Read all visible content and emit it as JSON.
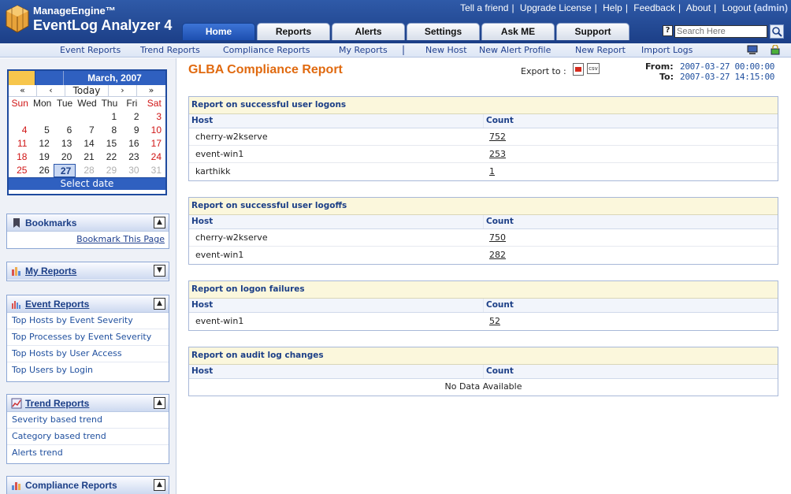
{
  "app": {
    "brand_top": "ManageEngine™",
    "brand_name": "EventLog Analyzer 4"
  },
  "top_links": [
    "Tell a friend",
    "Upgrade License",
    "Help",
    "Feedback",
    "About",
    "Logout"
  ],
  "user": "(admin)",
  "tabs": [
    {
      "label": "Home",
      "active": true
    },
    {
      "label": "Reports",
      "active": false
    },
    {
      "label": "Alerts",
      "active": false
    },
    {
      "label": "Settings",
      "active": false
    },
    {
      "label": "Ask ME",
      "active": false
    },
    {
      "label": "Support",
      "active": false
    }
  ],
  "search": {
    "placeholder": "Search Here",
    "help_icon": "question-icon",
    "button_icon": "magnifier-icon"
  },
  "subnav": [
    "Event Reports",
    "Trend Reports",
    "Compliance Reports",
    "My Reports",
    "New Host",
    "New Alert Profile",
    "New Report",
    "Import Logs"
  ],
  "subnav_sep": "|",
  "calendar": {
    "month": "March, 2007",
    "nav": [
      "«",
      "‹",
      "Today",
      "›",
      "»"
    ],
    "dow": [
      "Sun",
      "Mon",
      "Tue",
      "Wed",
      "Thu",
      "Fri",
      "Sat"
    ],
    "weeks": [
      [
        "",
        "",
        "",
        "",
        "1",
        "2",
        "3"
      ],
      [
        "4",
        "5",
        "6",
        "7",
        "8",
        "9",
        "10"
      ],
      [
        "11",
        "12",
        "13",
        "14",
        "15",
        "16",
        "17"
      ],
      [
        "18",
        "19",
        "20",
        "21",
        "22",
        "23",
        "24"
      ],
      [
        "25",
        "26",
        "27",
        "28",
        "29",
        "30",
        "31"
      ]
    ],
    "selected_day": "27",
    "select_label": "Select date"
  },
  "bookmarks": {
    "title": "Bookmarks",
    "link": "Bookmark This Page"
  },
  "my_reports": {
    "title": "My Reports"
  },
  "event_reports": {
    "title": "Event Reports",
    "items": [
      "Top Hosts by Event Severity",
      "Top Processes by Event Severity",
      "Top Hosts by User Access",
      "Top Users by Login"
    ]
  },
  "trend_reports": {
    "title": "Trend Reports",
    "items": [
      "Severity based trend",
      "Category based trend",
      "Alerts trend"
    ]
  },
  "compliance_reports": {
    "title": "Compliance Reports"
  },
  "report": {
    "title": "GLBA Compliance Report",
    "export_label": "Export to :",
    "export_formats": [
      "pdf",
      "csv"
    ],
    "from_label": "From:",
    "from_value": "2007-03-27  00:00:00",
    "to_label": "To:",
    "to_value": "2007-03-27  14:15:00",
    "col_host": "Host",
    "col_count": "Count",
    "sections": [
      {
        "title": "Report on successful user logons",
        "rows": [
          [
            "cherry-w2kserve",
            "752"
          ],
          [
            "event-win1",
            "253"
          ],
          [
            "karthikk",
            "1"
          ]
        ]
      },
      {
        "title": "Report on successful user logoffs",
        "rows": [
          [
            "cherry-w2kserve",
            "750"
          ],
          [
            "event-win1",
            "282"
          ]
        ]
      },
      {
        "title": "Report on logon failures",
        "rows": [
          [
            "event-win1",
            "52"
          ]
        ]
      },
      {
        "title": "Report on audit log changes",
        "rows": [],
        "empty": "No Data Available"
      }
    ]
  }
}
